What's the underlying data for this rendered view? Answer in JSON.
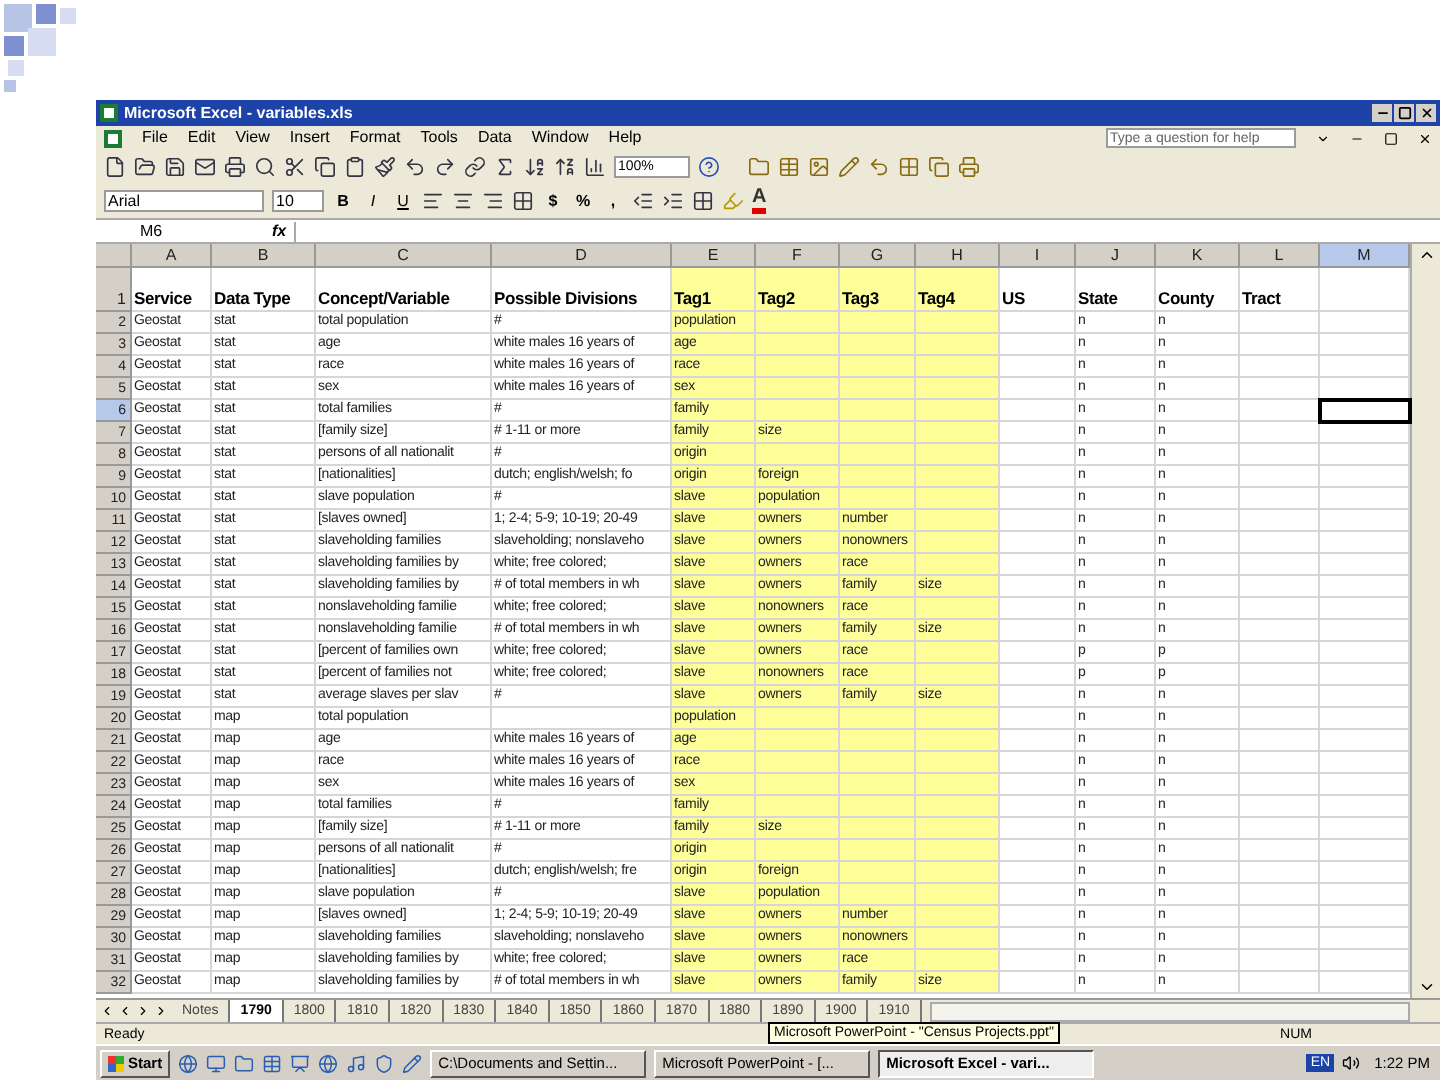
{
  "window": {
    "title": "Microsoft Excel - variables.xls"
  },
  "menu": [
    "File",
    "Edit",
    "View",
    "Insert",
    "Format",
    "Tools",
    "Data",
    "Window",
    "Help"
  ],
  "help_box": {
    "placeholder": "Type a question for help"
  },
  "standard_toolbar": {
    "zoom": "100%"
  },
  "format_toolbar": {
    "font": "Arial",
    "size": "10",
    "styles": [
      "B",
      "I",
      "U"
    ],
    "number_buttons": [
      "$",
      "%",
      ","
    ],
    "font_color": "A"
  },
  "formula_bar": {
    "name_box": "M6",
    "function_label": "fx"
  },
  "columns": [
    {
      "label": "A",
      "selected": false,
      "highlighted": false
    },
    {
      "label": "B",
      "selected": false,
      "highlighted": false
    },
    {
      "label": "C",
      "selected": false,
      "highlighted": false
    },
    {
      "label": "D",
      "selected": false,
      "highlighted": false
    },
    {
      "label": "E",
      "selected": false,
      "highlighted": true
    },
    {
      "label": "F",
      "selected": false,
      "highlighted": true
    },
    {
      "label": "G",
      "selected": false,
      "highlighted": true
    },
    {
      "label": "H",
      "selected": false,
      "highlighted": true
    },
    {
      "label": "I",
      "selected": false,
      "highlighted": false
    },
    {
      "label": "J",
      "selected": false,
      "highlighted": false
    },
    {
      "label": "K",
      "selected": false,
      "highlighted": false
    },
    {
      "label": "L",
      "selected": false,
      "highlighted": false
    },
    {
      "label": "M",
      "selected": true,
      "highlighted": false
    }
  ],
  "header_row": {
    "number": "1",
    "cells": {
      "A": "Service",
      "B": "Data Type",
      "C": "Concept/Variable",
      "D": "Possible Divisions",
      "E": "Tag1",
      "F": "Tag2",
      "G": "Tag3",
      "H": "Tag4",
      "I": "US",
      "J": "State",
      "K": "County",
      "L": "Tract"
    }
  },
  "rows": [
    {
      "number": "2",
      "selected": false,
      "cells": {
        "A": "Geostat",
        "B": "stat",
        "C": "total population",
        "D": "#",
        "E": "population",
        "J": "n",
        "K": "n"
      }
    },
    {
      "number": "3",
      "selected": false,
      "cells": {
        "A": "Geostat",
        "B": "stat",
        "C": "age",
        "D": "white males 16 years of",
        "E": "age",
        "J": "n",
        "K": "n"
      }
    },
    {
      "number": "4",
      "selected": false,
      "cells": {
        "A": "Geostat",
        "B": "stat",
        "C": "race",
        "D": "white males 16 years of",
        "E": "race",
        "J": "n",
        "K": "n"
      }
    },
    {
      "number": "5",
      "selected": false,
      "cells": {
        "A": "Geostat",
        "B": "stat",
        "C": "sex",
        "D": "white males 16 years of",
        "E": "sex",
        "J": "n",
        "K": "n"
      }
    },
    {
      "number": "6",
      "selected": true,
      "cells": {
        "A": "Geostat",
        "B": "stat",
        "C": "total families",
        "D": "#",
        "E": "family",
        "J": "n",
        "K": "n"
      }
    },
    {
      "number": "7",
      "selected": false,
      "cells": {
        "A": "Geostat",
        "B": "stat",
        "C": "[family size]",
        "D": "# 1-11 or more",
        "E": "family",
        "F": "size",
        "J": "n",
        "K": "n"
      }
    },
    {
      "number": "8",
      "selected": false,
      "cells": {
        "A": "Geostat",
        "B": "stat",
        "C": "persons of all nationalit",
        "D": "#",
        "E": "origin",
        "J": "n",
        "K": "n"
      }
    },
    {
      "number": "9",
      "selected": false,
      "cells": {
        "A": "Geostat",
        "B": "stat",
        "C": "[nationalities]",
        "D": "dutch; english/welsh; fo",
        "E": "origin",
        "F": "foreign",
        "J": "n",
        "K": "n"
      }
    },
    {
      "number": "10",
      "selected": false,
      "cells": {
        "A": "Geostat",
        "B": "stat",
        "C": "slave population",
        "D": "#",
        "E": "slave",
        "F": "population",
        "J": "n",
        "K": "n"
      }
    },
    {
      "number": "11",
      "selected": false,
      "cells": {
        "A": "Geostat",
        "B": "stat",
        "C": "[slaves owned]",
        "D": "1; 2-4; 5-9; 10-19; 20-49",
        "E": "slave",
        "F": "owners",
        "G": "number",
        "J": "n",
        "K": "n"
      }
    },
    {
      "number": "12",
      "selected": false,
      "cells": {
        "A": "Geostat",
        "B": "stat",
        "C": "slaveholding families",
        "D": "slaveholding; nonslaveho",
        "E": "slave",
        "F": "owners",
        "G": "nonowners",
        "J": "n",
        "K": "n"
      }
    },
    {
      "number": "13",
      "selected": false,
      "cells": {
        "A": "Geostat",
        "B": "stat",
        "C": "slaveholding families by",
        "D": "white; free colored;",
        "E": "slave",
        "F": "owners",
        "G": "race",
        "J": "n",
        "K": "n"
      }
    },
    {
      "number": "14",
      "selected": false,
      "cells": {
        "A": "Geostat",
        "B": "stat",
        "C": "slaveholding families by",
        "D": "# of total members in wh",
        "E": "slave",
        "F": "owners",
        "G": "family",
        "H": "size",
        "J": "n",
        "K": "n"
      }
    },
    {
      "number": "15",
      "selected": false,
      "cells": {
        "A": "Geostat",
        "B": "stat",
        "C": "nonslaveholding familie",
        "D": "white; free colored;",
        "E": "slave",
        "F": "nonowners",
        "G": "race",
        "J": "n",
        "K": "n"
      }
    },
    {
      "number": "16",
      "selected": false,
      "cells": {
        "A": "Geostat",
        "B": "stat",
        "C": "nonslaveholding familie",
        "D": "# of total members in wh",
        "E": "slave",
        "F": "owners",
        "G": "family",
        "H": "size",
        "J": "n",
        "K": "n"
      }
    },
    {
      "number": "17",
      "selected": false,
      "cells": {
        "A": "Geostat",
        "B": "stat",
        "C": "[percent of families own",
        "D": "white; free colored;",
        "E": "slave",
        "F": "owners",
        "G": "race",
        "J": "p",
        "K": "p"
      }
    },
    {
      "number": "18",
      "selected": false,
      "cells": {
        "A": "Geostat",
        "B": "stat",
        "C": "[percent of families not",
        "D": "white; free colored;",
        "E": "slave",
        "F": "nonowners",
        "G": "race",
        "J": "p",
        "K": "p"
      }
    },
    {
      "number": "19",
      "selected": false,
      "cells": {
        "A": "Geostat",
        "B": "stat",
        "C": "average slaves per slav",
        "D": "#",
        "E": "slave",
        "F": "owners",
        "G": "family",
        "H": "size",
        "J": "n",
        "K": "n"
      }
    },
    {
      "number": "20",
      "selected": false,
      "cells": {
        "A": "Geostat",
        "B": "map",
        "C": "total population",
        "E": "population",
        "J": "n",
        "K": "n"
      }
    },
    {
      "number": "21",
      "selected": false,
      "cells": {
        "A": "Geostat",
        "B": "map",
        "C": "age",
        "D": "white males 16 years of",
        "E": "age",
        "J": "n",
        "K": "n"
      }
    },
    {
      "number": "22",
      "selected": false,
      "cells": {
        "A": "Geostat",
        "B": "map",
        "C": "race",
        "D": "white males 16 years of",
        "E": "race",
        "J": "n",
        "K": "n"
      }
    },
    {
      "number": "23",
      "selected": false,
      "cells": {
        "A": "Geostat",
        "B": "map",
        "C": "sex",
        "D": "white males 16 years of",
        "E": "sex",
        "J": "n",
        "K": "n"
      }
    },
    {
      "number": "24",
      "selected": false,
      "cells": {
        "A": "Geostat",
        "B": "map",
        "C": "total families",
        "D": "#",
        "E": "family",
        "J": "n",
        "K": "n"
      }
    },
    {
      "number": "25",
      "selected": false,
      "cells": {
        "A": "Geostat",
        "B": "map",
        "C": "[family size]",
        "D": "# 1-11 or more",
        "E": "family",
        "F": "size",
        "J": "n",
        "K": "n"
      }
    },
    {
      "number": "26",
      "selected": false,
      "cells": {
        "A": "Geostat",
        "B": "map",
        "C": "persons of all nationalit",
        "D": "#",
        "E": "origin",
        "J": "n",
        "K": "n"
      }
    },
    {
      "number": "27",
      "selected": false,
      "cells": {
        "A": "Geostat",
        "B": "map",
        "C": "[nationalities]",
        "D": "dutch; english/welsh; fre",
        "E": "origin",
        "F": "foreign",
        "J": "n",
        "K": "n"
      }
    },
    {
      "number": "28",
      "selected": false,
      "cells": {
        "A": "Geostat",
        "B": "map",
        "C": "slave population",
        "D": "#",
        "E": "slave",
        "F": "population",
        "J": "n",
        "K": "n"
      }
    },
    {
      "number": "29",
      "selected": false,
      "cells": {
        "A": "Geostat",
        "B": "map",
        "C": "[slaves owned]",
        "D": "1; 2-4; 5-9; 10-19; 20-49",
        "E": "slave",
        "F": "owners",
        "G": "number",
        "J": "n",
        "K": "n"
      }
    },
    {
      "number": "30",
      "selected": false,
      "cells": {
        "A": "Geostat",
        "B": "map",
        "C": "slaveholding families",
        "D": "slaveholding; nonslaveho",
        "E": "slave",
        "F": "owners",
        "G": "nonowners",
        "J": "n",
        "K": "n"
      }
    },
    {
      "number": "31",
      "selected": false,
      "cells": {
        "A": "Geostat",
        "B": "map",
        "C": "slaveholding families by",
        "D": "white; free colored;",
        "E": "slave",
        "F": "owners",
        "G": "race",
        "J": "n",
        "K": "n"
      }
    },
    {
      "number": "32",
      "selected": false,
      "cells": {
        "A": "Geostat",
        "B": "map",
        "C": "slaveholding families by",
        "D": "# of total members in wh",
        "E": "slave",
        "F": "owners",
        "G": "family",
        "H": "size",
        "J": "n",
        "K": "n"
      }
    }
  ],
  "sheet_tabs": [
    {
      "label": "Notes",
      "selected": false
    },
    {
      "label": "1790",
      "selected": true
    },
    {
      "label": "1800",
      "selected": false
    },
    {
      "label": "1810",
      "selected": false
    },
    {
      "label": "1820",
      "selected": false
    },
    {
      "label": "1830",
      "selected": false
    },
    {
      "label": "1840",
      "selected": false
    },
    {
      "label": "1850",
      "selected": false
    },
    {
      "label": "1860",
      "selected": false
    },
    {
      "label": "1870",
      "selected": false
    },
    {
      "label": "1880",
      "selected": false
    },
    {
      "label": "1890",
      "selected": false
    },
    {
      "label": "1900",
      "selected": false
    },
    {
      "label": "1910",
      "selected": false
    }
  ],
  "status_bar": {
    "state": "Ready",
    "keys": "NUM"
  },
  "taskbar": {
    "start": "Start",
    "tasks": [
      {
        "label": "C:\\Documents and Settin...",
        "selected": false
      },
      {
        "label": "Microsoft PowerPoint - [...",
        "selected": false
      },
      {
        "label": "Microsoft Excel - vari...",
        "selected": true
      }
    ],
    "language": "EN",
    "clock": "1:22 PM",
    "tooltip": "Microsoft PowerPoint - \"Census Projects.ppt\""
  }
}
